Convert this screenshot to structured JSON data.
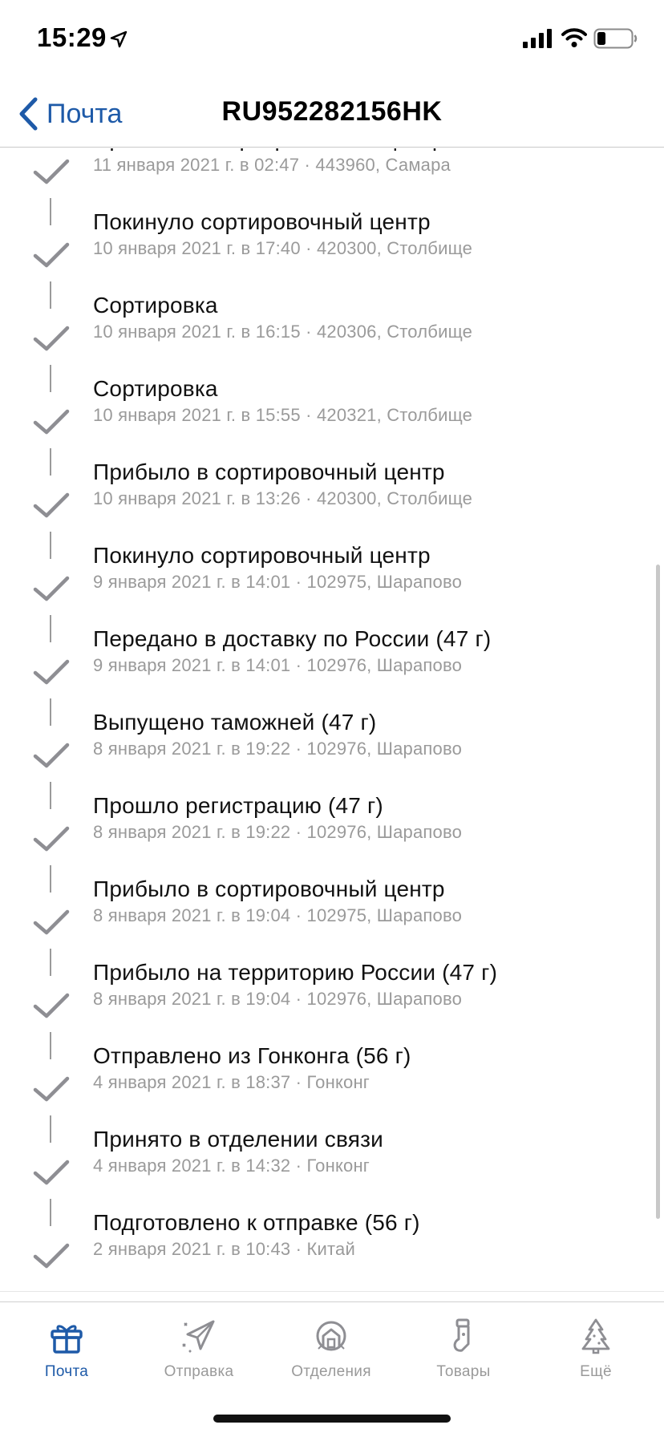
{
  "status_bar": {
    "time": "15:29"
  },
  "nav": {
    "back_label": "Почта",
    "title": "RU952282156HK"
  },
  "events": [
    {
      "title": "Прибыло в сортировочный центр",
      "detail": "11 января 2021 г. в 02:47 · 443960, Самара"
    },
    {
      "title": "Покинуло сортировочный центр",
      "detail": "10 января 2021 г. в 17:40 · 420300, Столбище"
    },
    {
      "title": "Сортировка",
      "detail": "10 января 2021 г. в 16:15 · 420306, Столбище"
    },
    {
      "title": "Сортировка",
      "detail": "10 января 2021 г. в 15:55 · 420321, Столбище"
    },
    {
      "title": "Прибыло в сортировочный центр",
      "detail": "10 января 2021 г. в 13:26 · 420300, Столбище"
    },
    {
      "title": "Покинуло сортировочный центр",
      "detail": "9 января 2021 г. в 14:01 · 102975, Шарапово"
    },
    {
      "title": "Передано в доставку по России  (47 г)",
      "detail": "9 января 2021 г. в 14:01 · 102976, Шарапово"
    },
    {
      "title": "Выпущено таможней  (47 г)",
      "detail": "8 января 2021 г. в 19:22 · 102976, Шарапово"
    },
    {
      "title": "Прошло регистрацию  (47 г)",
      "detail": "8 января 2021 г. в 19:22 · 102976, Шарапово"
    },
    {
      "title": "Прибыло в сортировочный центр",
      "detail": "8 января 2021 г. в 19:04 · 102975, Шарапово"
    },
    {
      "title": "Прибыло на территорию России  (47 г)",
      "detail": "8 января 2021 г. в 19:04 · 102976, Шарапово"
    },
    {
      "title": "Отправлено из Гонконга  (56 г)",
      "detail": "4 января 2021 г. в 18:37 · Гонконг"
    },
    {
      "title": "Принято в отделении связи",
      "detail": "4 января 2021 г. в 14:32 · Гонконг"
    },
    {
      "title": "Подготовлено к отправке  (56 г)",
      "detail": "2 января 2021 г. в 10:43 · Китай"
    }
  ],
  "tabs": [
    {
      "label": "Почта",
      "icon": "gift-icon",
      "active": true
    },
    {
      "label": "Отправка",
      "icon": "paper-plane-icon",
      "active": false
    },
    {
      "label": "Отделения",
      "icon": "post-office-icon",
      "active": false
    },
    {
      "label": "Товары",
      "icon": "stocking-icon",
      "active": false
    },
    {
      "label": "Ещё",
      "icon": "christmas-tree-icon",
      "active": false
    }
  ],
  "colors": {
    "accent": "#1e5aa8",
    "secondary_text": "#9a9a9a",
    "icon_gray": "#8e8e93"
  }
}
